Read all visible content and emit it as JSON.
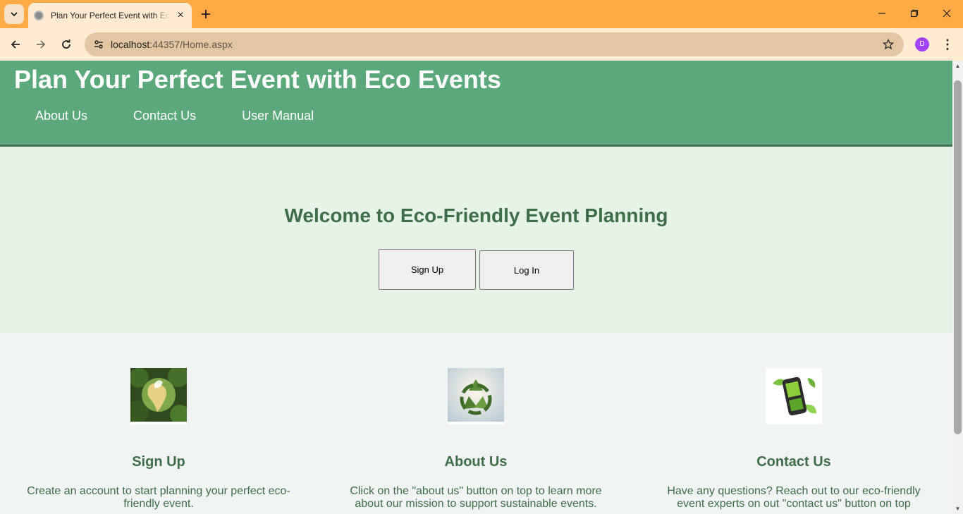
{
  "browser": {
    "tab_title": "Plan Your Perfect Event with Eco Events",
    "url_host": "localhost",
    "url_path": ":44357/Home.aspx",
    "profile_initial": "D",
    "icons": {
      "tab_search": "chevron-down-icon",
      "tab_close": "close-icon",
      "new_tab": "plus-icon",
      "back": "arrow-left-icon",
      "forward": "arrow-right-icon",
      "reload": "reload-icon",
      "site_info": "tune-icon",
      "bookmark": "star-icon",
      "menu": "kebab-menu-icon",
      "minimize": "minimize-icon",
      "restore": "restore-icon",
      "close_window": "close-icon"
    },
    "colors": {
      "tabstrip": "#ffaa44",
      "toolbar": "#ffebd1",
      "omnibox": "#e3c6a4",
      "profile": "#a142f4"
    }
  },
  "page": {
    "header": {
      "title": "Plan Your Perfect Event with Eco Events",
      "nav": [
        "About Us",
        "Contact Us",
        "User Manual"
      ]
    },
    "hero": {
      "title": "Welcome to Eco-Friendly Event Planning",
      "signup_label": "Sign Up",
      "login_label": "Log In"
    },
    "features": [
      {
        "title": "Sign Up",
        "text": "Create an account to start planning your perfect eco-friendly event.",
        "image": "eco-earth-forest-image"
      },
      {
        "title": "About Us",
        "text": "Click on the \"about us\" button on top to learn more about our mission to support sustainable events.",
        "image": "recycle-leaves-image"
      },
      {
        "title": "Contact Us",
        "text": "Have any questions? Reach out to our eco-friendly event experts on out \"contact us\" button on top",
        "image": "green-phone-image"
      }
    ],
    "colors": {
      "header": "#5ba97a",
      "hero": "#e6f4e8",
      "accent_text": "#3d6e47",
      "body": "#f0f4f2"
    }
  }
}
